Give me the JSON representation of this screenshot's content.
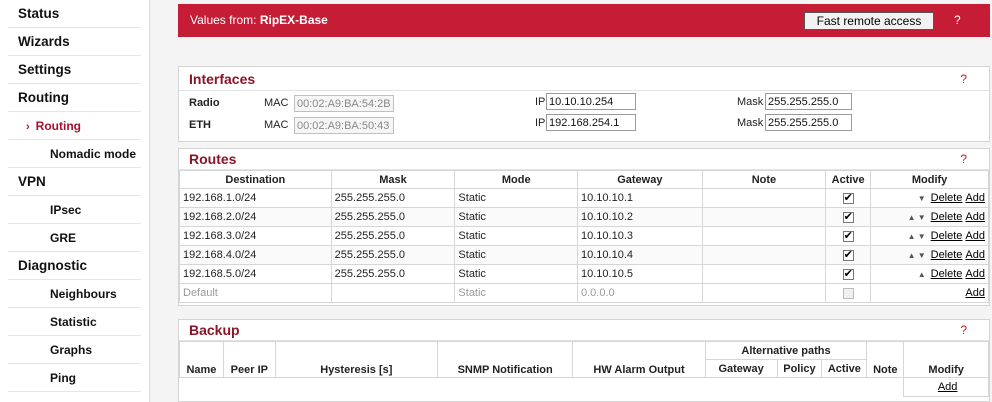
{
  "sidebar": {
    "items": [
      {
        "label": "Status"
      },
      {
        "label": "Wizards"
      },
      {
        "label": "Settings"
      },
      {
        "label": "Routing"
      },
      {
        "label": "Routing"
      },
      {
        "label": "Nomadic mode"
      },
      {
        "label": "VPN"
      },
      {
        "label": "IPsec"
      },
      {
        "label": "GRE"
      },
      {
        "label": "Diagnostic"
      },
      {
        "label": "Neighbours"
      },
      {
        "label": "Statistic"
      },
      {
        "label": "Graphs"
      },
      {
        "label": "Ping"
      }
    ],
    "active_marker": "›"
  },
  "header": {
    "values_from_label": "Values from:",
    "values_from_name": "RipEX-Base",
    "fast_remote_access": "Fast remote access",
    "help": "?"
  },
  "interfaces": {
    "title": "Interfaces",
    "help": "?",
    "radio": {
      "label": "Radio",
      "mac_label": "MAC",
      "mac": "00:02:A9:BA:54:2B",
      "ip_label": "IP",
      "ip": "10.10.10.254",
      "mask_label": "Mask",
      "mask": "255.255.255.0"
    },
    "eth": {
      "label": "ETH",
      "mac_label": "MAC",
      "mac": "00:02:A9:BA:50:43",
      "ip_label": "IP",
      "ip": "192.168.254.1",
      "mask_label": "Mask",
      "mask": "255.255.255.0"
    }
  },
  "routes": {
    "title": "Routes",
    "help": "?",
    "columns": [
      "Destination",
      "Mask",
      "Mode",
      "Gateway",
      "Note",
      "Active",
      "Modify"
    ],
    "rows": [
      {
        "destination": "192.168.1.0/24",
        "mask": "255.255.255.0",
        "mode": "Static",
        "gateway": "10.10.10.1",
        "note": "",
        "arrows": "▼"
      },
      {
        "destination": "192.168.2.0/24",
        "mask": "255.255.255.0",
        "mode": "Static",
        "gateway": "10.10.10.2",
        "note": "",
        "arrows": "▲ ▼"
      },
      {
        "destination": "192.168.3.0/24",
        "mask": "255.255.255.0",
        "mode": "Static",
        "gateway": "10.10.10.3",
        "note": "",
        "arrows": "▲ ▼"
      },
      {
        "destination": "192.168.4.0/24",
        "mask": "255.255.255.0",
        "mode": "Static",
        "gateway": "10.10.10.4",
        "note": "",
        "arrows": "▲ ▼"
      },
      {
        "destination": "192.168.5.0/24",
        "mask": "255.255.255.0",
        "mode": "Static",
        "gateway": "10.10.10.5",
        "note": "",
        "arrows": "▲"
      }
    ],
    "default_row": {
      "destination": "Default",
      "mode": "Static",
      "gateway": "0.0.0.0"
    },
    "delete_label": "Delete",
    "add_label": "Add"
  },
  "backup": {
    "title": "Backup",
    "help": "?",
    "columns": {
      "name": "Name",
      "peer_ip": "Peer IP",
      "hysteresis": "Hysteresis [s]",
      "snmp": "SNMP Notification",
      "hw_alarm": "HW Alarm Output",
      "alt_paths": "Alternative paths",
      "gateway": "Gateway",
      "policy": "Policy",
      "active": "Active",
      "note": "Note",
      "modify": "Modify"
    },
    "add_label": "Add"
  },
  "colors": {
    "accent": "#c51d35",
    "title": "#8b1527"
  }
}
